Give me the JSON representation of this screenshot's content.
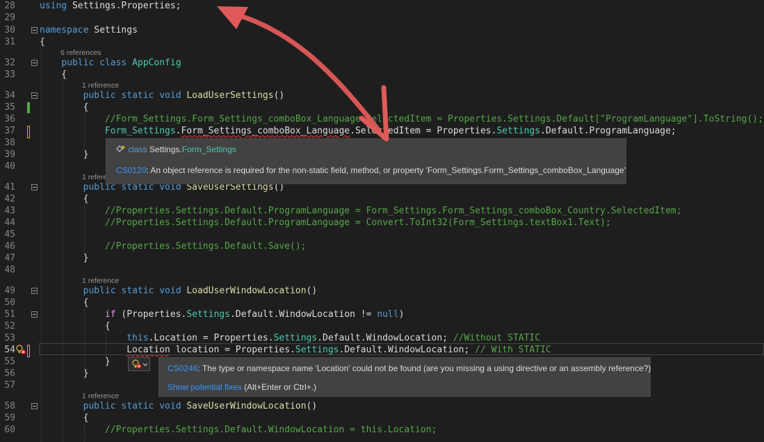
{
  "lines": [
    {
      "n": "28",
      "tokens": [
        {
          "t": "using",
          "c": "kw"
        },
        {
          "t": " Settings.Properties;"
        }
      ]
    },
    {
      "n": "29",
      "tokens": []
    },
    {
      "n": "30",
      "tokens": [
        {
          "t": "namespace",
          "c": "kw"
        },
        {
          "t": " Settings"
        }
      ]
    },
    {
      "n": "31",
      "tokens": [
        {
          "t": "{"
        }
      ]
    },
    {
      "n": "32",
      "tokens": [
        {
          "t": "    "
        },
        {
          "t": "public",
          "c": "kw"
        },
        {
          "t": " "
        },
        {
          "t": "class",
          "c": "kw"
        },
        {
          "t": " "
        },
        {
          "t": "AppConfig",
          "c": "ty"
        }
      ]
    },
    {
      "n": "33",
      "tokens": [
        {
          "t": "    {"
        }
      ]
    },
    {
      "n": "34",
      "tokens": [
        {
          "t": "        "
        },
        {
          "t": "public",
          "c": "kw"
        },
        {
          "t": " "
        },
        {
          "t": "static",
          "c": "kw"
        },
        {
          "t": " "
        },
        {
          "t": "void",
          "c": "kw"
        },
        {
          "t": " "
        },
        {
          "t": "LoadUserSettings",
          "c": "me"
        },
        {
          "t": "()"
        }
      ]
    },
    {
      "n": "35",
      "tokens": [
        {
          "t": "        {"
        }
      ]
    },
    {
      "n": "36",
      "tokens": [
        {
          "t": "            "
        },
        {
          "t": "//Form_Settings.Form_Settings_comboBox_Language.SelectedItem = Properties.Settings.Default[\"ProgramLanguage\"].ToString();",
          "c": "cm"
        }
      ]
    },
    {
      "n": "37",
      "tokens": [
        {
          "t": "            "
        },
        {
          "t": "Form_Settings",
          "c": "ty"
        },
        {
          "t": "."
        },
        {
          "t": "Form_Settings_comboBox_Language",
          "c": "sq"
        },
        {
          "t": ".SelectedItem = Properties."
        },
        {
          "t": "Settings",
          "c": "ty"
        },
        {
          "t": ".Default.ProgramLanguage;"
        }
      ]
    },
    {
      "n": "38",
      "tokens": [
        {
          "t": "            "
        },
        {
          "t": "/",
          "c": "cm"
        }
      ]
    },
    {
      "n": "39",
      "tokens": [
        {
          "t": "        }"
        }
      ]
    },
    {
      "n": "40",
      "tokens": []
    },
    {
      "n": "41",
      "tokens": [
        {
          "t": "        "
        },
        {
          "t": "public",
          "c": "kw"
        },
        {
          "t": " "
        },
        {
          "t": "static",
          "c": "kw"
        },
        {
          "t": " "
        },
        {
          "t": "void",
          "c": "kw"
        },
        {
          "t": " "
        },
        {
          "t": "SaveUserSettings",
          "c": "me"
        },
        {
          "t": "()"
        }
      ]
    },
    {
      "n": "42",
      "tokens": [
        {
          "t": "        {"
        }
      ]
    },
    {
      "n": "43",
      "tokens": [
        {
          "t": "            "
        },
        {
          "t": "//Properties.Settings.Default.ProgramLanguage = Form_Settings.Form_Settings_comboBox_Country.SelectedItem;",
          "c": "cm"
        }
      ]
    },
    {
      "n": "44",
      "tokens": [
        {
          "t": "            "
        },
        {
          "t": "//Properties.Settings.Default.ProgramLanguage = Convert.ToInt32(Form_Settings.textBox1.Text);",
          "c": "cm"
        }
      ]
    },
    {
      "n": "45",
      "tokens": []
    },
    {
      "n": "46",
      "tokens": [
        {
          "t": "            "
        },
        {
          "t": "//Properties.Settings.Default.Save();",
          "c": "cm"
        }
      ]
    },
    {
      "n": "47",
      "tokens": [
        {
          "t": "        }"
        }
      ]
    },
    {
      "n": "48",
      "tokens": []
    },
    {
      "n": "49",
      "tokens": [
        {
          "t": "        "
        },
        {
          "t": "public",
          "c": "kw"
        },
        {
          "t": " "
        },
        {
          "t": "static",
          "c": "kw"
        },
        {
          "t": " "
        },
        {
          "t": "void",
          "c": "kw"
        },
        {
          "t": " "
        },
        {
          "t": "LoadUserWindowLocation",
          "c": "me"
        },
        {
          "t": "()"
        }
      ]
    },
    {
      "n": "50",
      "tokens": [
        {
          "t": "        {"
        }
      ]
    },
    {
      "n": "51",
      "tokens": [
        {
          "t": "            "
        },
        {
          "t": "if",
          "c": "ctl"
        },
        {
          "t": " (Properties."
        },
        {
          "t": "Settings",
          "c": "ty"
        },
        {
          "t": ".Default.WindowLocation != "
        },
        {
          "t": "null",
          "c": "kw"
        },
        {
          "t": ")"
        }
      ]
    },
    {
      "n": "52",
      "tokens": [
        {
          "t": "            {"
        }
      ]
    },
    {
      "n": "53",
      "tokens": [
        {
          "t": "                "
        },
        {
          "t": "this",
          "c": "kw"
        },
        {
          "t": ".Location = Properties."
        },
        {
          "t": "Settings",
          "c": "ty"
        },
        {
          "t": ".Default.WindowLocation; "
        },
        {
          "t": "//Without STATIC",
          "c": "cm"
        }
      ]
    },
    {
      "n": "54",
      "tokens": [
        {
          "t": "                "
        },
        {
          "t": "Location",
          "c": "sq"
        },
        {
          "t": " location = Properties."
        },
        {
          "t": "Settings",
          "c": "ty"
        },
        {
          "t": ".Default.WindowLocation; "
        },
        {
          "t": "// With STATIC",
          "c": "cm"
        }
      ]
    },
    {
      "n": "55",
      "tokens": [
        {
          "t": "            }"
        }
      ]
    },
    {
      "n": "56",
      "tokens": [
        {
          "t": "        }"
        }
      ]
    },
    {
      "n": "57",
      "tokens": []
    },
    {
      "n": "58",
      "tokens": [
        {
          "t": "        "
        },
        {
          "t": "public",
          "c": "kw"
        },
        {
          "t": " "
        },
        {
          "t": "static",
          "c": "kw"
        },
        {
          "t": " "
        },
        {
          "t": "void",
          "c": "kw"
        },
        {
          "t": " "
        },
        {
          "t": "SaveUserWindowLocation",
          "c": "me"
        },
        {
          "t": "()"
        }
      ]
    },
    {
      "n": "59",
      "tokens": [
        {
          "t": "        {"
        }
      ]
    },
    {
      "n": "60",
      "tokens": [
        {
          "t": "            "
        },
        {
          "t": "//Properties.Settings.Default.WindowLocation = this.Location;",
          "c": "cm"
        }
      ]
    }
  ],
  "codelens": {
    "appconfig": "6 references",
    "load_user_settings": "1 reference",
    "save_user_settings": "1 refere",
    "load_user_window_location": "1 reference",
    "save_user_window_location": "1 reference"
  },
  "tooltip1": {
    "kind": "class",
    "ns": "Settings.",
    "type": "Form_Settings",
    "code": "CS0120",
    "message": ": An object reference is required for the non-static field, method, or property 'Form_Settings.Form_Settings_comboBox_Language'"
  },
  "tooltip2": {
    "code": "CS0246",
    "message": ": The type or namespace name 'Location' could not be found (are you missing a using directive or an assembly reference?)",
    "fix_link": "Show potential fixes",
    "fix_shortcut": " (Alt+Enter or Ctrl+.)"
  },
  "colors": {
    "background": "#1e1e1e",
    "keyword": "#569cd6",
    "type": "#4ec9b0",
    "method": "#dcdcaa",
    "comment": "#57a64a",
    "annotation_arrow": "#e05a5a"
  },
  "icons": [
    "lightbulb-error-icon",
    "class-icon",
    "chevron-down-icon"
  ]
}
